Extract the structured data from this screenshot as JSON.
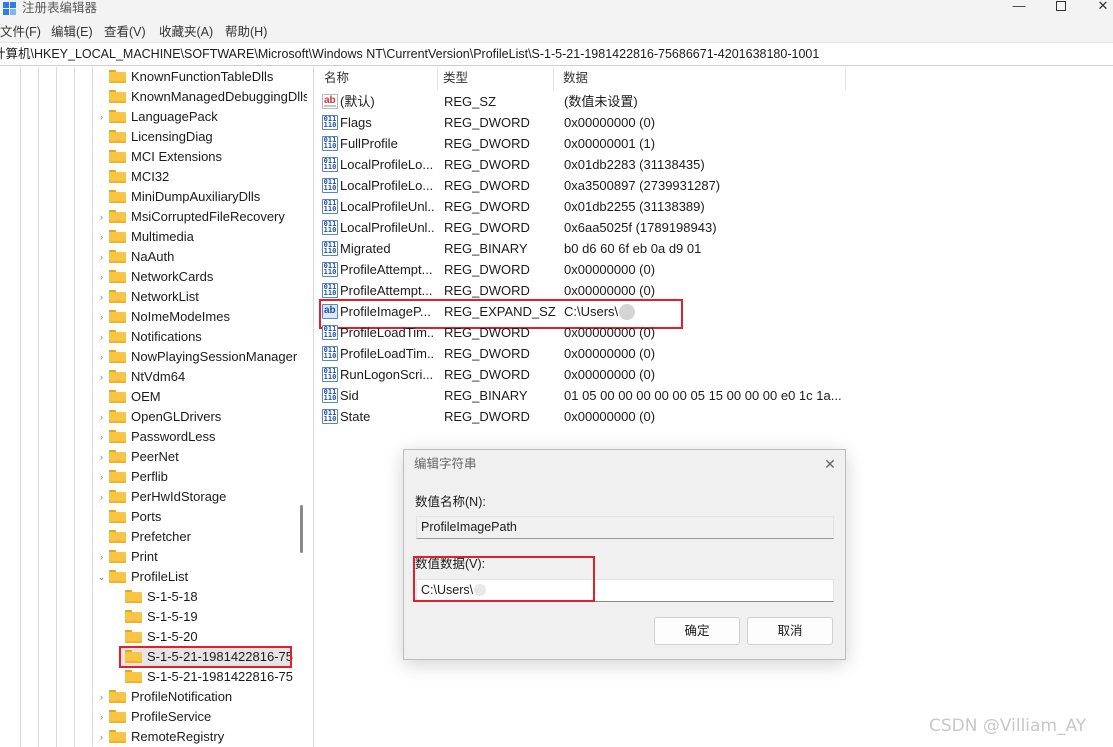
{
  "window": {
    "title": "注册表编辑器",
    "minimize_glyph": "—",
    "close_glyph": "✕"
  },
  "menu": [
    "文件(F)",
    "编辑(E)",
    "查看(V)",
    "收藏夹(A)",
    "帮助(H)"
  ],
  "address": "计算机\\HKEY_LOCAL_MACHINE\\SOFTWARE\\Microsoft\\Windows NT\\CurrentVersion\\ProfileList\\S-1-5-21-1981422816-75686671-4201638180-1001",
  "tree": {
    "collapsed_glyph": "›",
    "expanded_glyph": "⌄",
    "items": [
      {
        "label": "KnownFunctionTableDlls",
        "chevron": false,
        "level": 0
      },
      {
        "label": "KnownManagedDebuggingDlls",
        "chevron": false,
        "level": 0
      },
      {
        "label": "LanguagePack",
        "chevron": true,
        "level": 0
      },
      {
        "label": "LicensingDiag",
        "chevron": false,
        "level": 0
      },
      {
        "label": "MCI Extensions",
        "chevron": false,
        "level": 0
      },
      {
        "label": "MCI32",
        "chevron": false,
        "level": 0
      },
      {
        "label": "MiniDumpAuxiliaryDlls",
        "chevron": false,
        "level": 0
      },
      {
        "label": "MsiCorruptedFileRecovery",
        "chevron": true,
        "level": 0
      },
      {
        "label": "Multimedia",
        "chevron": true,
        "level": 0
      },
      {
        "label": "NaAuth",
        "chevron": true,
        "level": 0
      },
      {
        "label": "NetworkCards",
        "chevron": true,
        "level": 0
      },
      {
        "label": "NetworkList",
        "chevron": true,
        "level": 0
      },
      {
        "label": "NoImeModeImes",
        "chevron": true,
        "level": 0
      },
      {
        "label": "Notifications",
        "chevron": true,
        "level": 0
      },
      {
        "label": "NowPlayingSessionManager",
        "chevron": true,
        "level": 0
      },
      {
        "label": "NtVdm64",
        "chevron": true,
        "level": 0
      },
      {
        "label": "OEM",
        "chevron": false,
        "level": 0
      },
      {
        "label": "OpenGLDrivers",
        "chevron": true,
        "level": 0
      },
      {
        "label": "PasswordLess",
        "chevron": true,
        "level": 0
      },
      {
        "label": "PeerNet",
        "chevron": true,
        "level": 0
      },
      {
        "label": "Perflib",
        "chevron": true,
        "level": 0
      },
      {
        "label": "PerHwIdStorage",
        "chevron": true,
        "level": 0
      },
      {
        "label": "Ports",
        "chevron": false,
        "level": 0
      },
      {
        "label": "Prefetcher",
        "chevron": false,
        "level": 0
      },
      {
        "label": "Print",
        "chevron": true,
        "level": 0
      },
      {
        "label": "ProfileList",
        "chevron": true,
        "expanded": true,
        "level": 0
      },
      {
        "label": "S-1-5-18",
        "chevron": false,
        "level": 1
      },
      {
        "label": "S-1-5-19",
        "chevron": false,
        "level": 1
      },
      {
        "label": "S-1-5-20",
        "chevron": false,
        "level": 1
      },
      {
        "label": "S-1-5-21-1981422816-75",
        "chevron": false,
        "level": 1,
        "selected": true
      },
      {
        "label": "S-1-5-21-1981422816-75",
        "chevron": false,
        "level": 1
      },
      {
        "label": "ProfileNotification",
        "chevron": true,
        "level": 0
      },
      {
        "label": "ProfileService",
        "chevron": true,
        "level": 0
      },
      {
        "label": "RemoteRegistry",
        "chevron": true,
        "level": 0
      }
    ]
  },
  "values_pane": {
    "columns": [
      "名称",
      "类型",
      "数据"
    ],
    "rows": [
      {
        "icon": "string-value-icon",
        "name": "(默认)",
        "type": "REG_SZ",
        "data": "(数值未设置)"
      },
      {
        "icon": "binary-value-icon",
        "name": "Flags",
        "type": "REG_DWORD",
        "data": "0x00000000 (0)"
      },
      {
        "icon": "binary-value-icon",
        "name": "FullProfile",
        "type": "REG_DWORD",
        "data": "0x00000001 (1)"
      },
      {
        "icon": "binary-value-icon",
        "name": "LocalProfileLo...",
        "type": "REG_DWORD",
        "data": "0x01db2283 (31138435)"
      },
      {
        "icon": "binary-value-icon",
        "name": "LocalProfileLo...",
        "type": "REG_DWORD",
        "data": "0xa3500897 (2739931287)"
      },
      {
        "icon": "binary-value-icon",
        "name": "LocalProfileUnl...",
        "type": "REG_DWORD",
        "data": "0x01db2255 (31138389)"
      },
      {
        "icon": "binary-value-icon",
        "name": "LocalProfileUnl...",
        "type": "REG_DWORD",
        "data": "0x6aa5025f (1789198943)"
      },
      {
        "icon": "binary-value-icon",
        "name": "Migrated",
        "type": "REG_BINARY",
        "data": "b0 d6 60 6f eb 0a d9 01"
      },
      {
        "icon": "binary-value-icon",
        "name": "ProfileAttempt...",
        "type": "REG_DWORD",
        "data": "0x00000000 (0)"
      },
      {
        "icon": "binary-value-icon",
        "name": "ProfileAttempt...",
        "type": "REG_DWORD",
        "data": "0x00000000 (0)"
      },
      {
        "icon": "expand-string-value-icon",
        "name": "ProfileImageP...",
        "type": "REG_EXPAND_SZ",
        "data": "C:\\Users\\",
        "highlighted": true,
        "redacted": true
      },
      {
        "icon": "binary-value-icon",
        "name": "ProfileLoadTim...",
        "type": "REG_DWORD",
        "data": "0x00000000 (0)"
      },
      {
        "icon": "binary-value-icon",
        "name": "ProfileLoadTim...",
        "type": "REG_DWORD",
        "data": "0x00000000 (0)"
      },
      {
        "icon": "binary-value-icon",
        "name": "RunLogonScri...",
        "type": "REG_DWORD",
        "data": "0x00000000 (0)"
      },
      {
        "icon": "binary-value-icon",
        "name": "Sid",
        "type": "REG_BINARY",
        "data": "01 05 00 00 00 00 00 05 15 00 00 00 e0 1c 1a..."
      },
      {
        "icon": "binary-value-icon",
        "name": "State",
        "type": "REG_DWORD",
        "data": "0x00000000 (0)"
      }
    ]
  },
  "dialog": {
    "title": "编辑字符串",
    "close_glyph": "✕",
    "name_label": "数值名称(N):",
    "name_value": "ProfileImagePath",
    "data_label": "数值数据(V):",
    "data_value": "C:\\Users\\",
    "ok_label": "确定",
    "cancel_label": "取消"
  },
  "watermark": "CSDN @Villiam_AY",
  "colors": {
    "highlight_box": "#e0202a",
    "folder": "#f8c545",
    "selection": "#e5e5e5"
  }
}
